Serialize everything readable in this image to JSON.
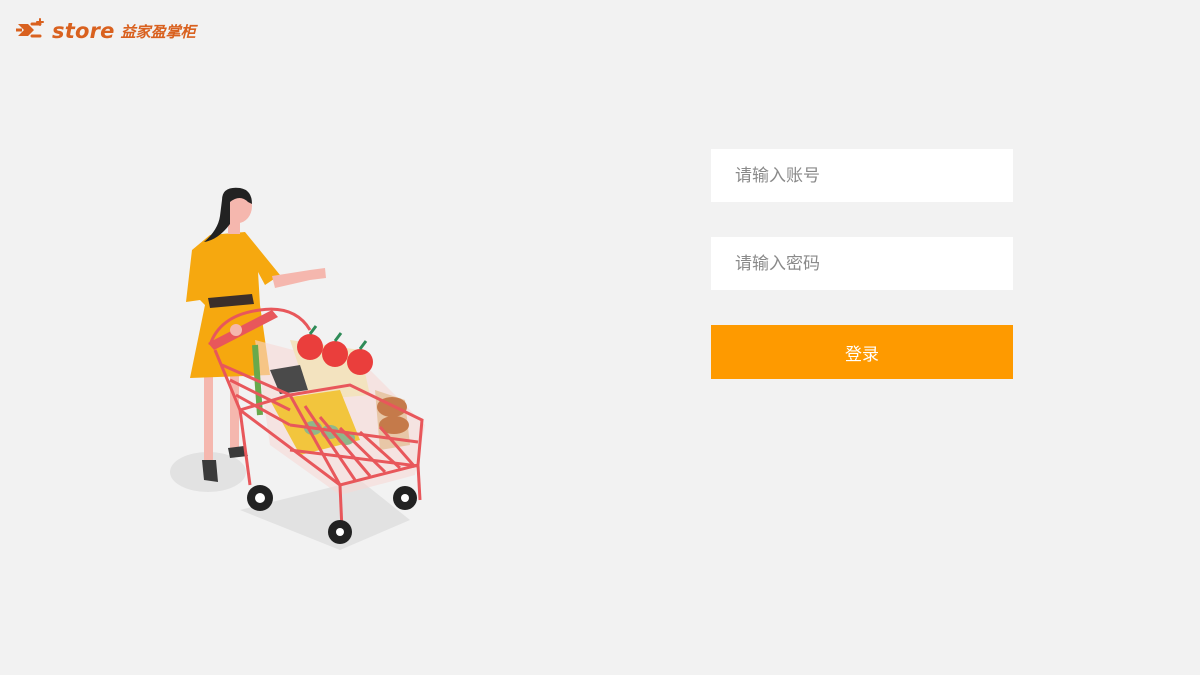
{
  "brand": {
    "name_en": "store",
    "name_cn": "益家盈掌柜",
    "color": "#d9611f"
  },
  "login": {
    "account_placeholder": "请输入账号",
    "password_placeholder": "请输入密码",
    "submit_label": "登录",
    "accent": "#fe9a00"
  },
  "illustration": {
    "icon": "woman-with-shopping-cart-illustration"
  }
}
